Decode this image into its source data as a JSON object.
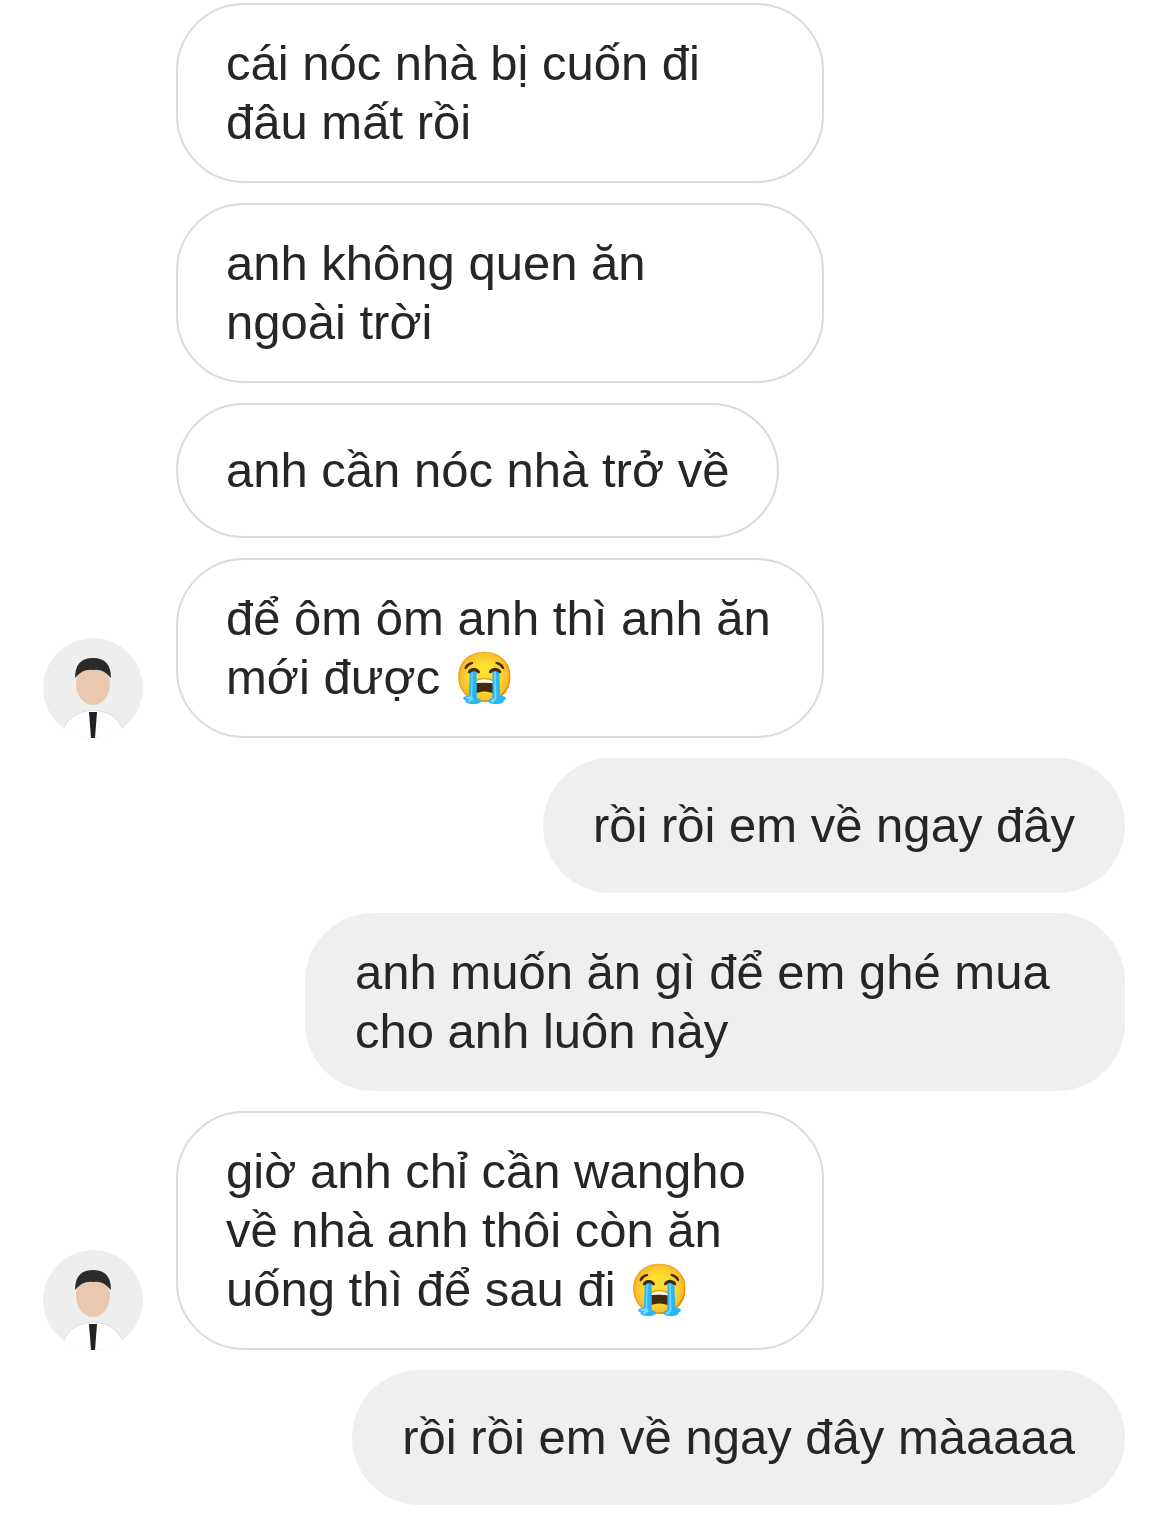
{
  "messages": [
    {
      "kind": "incoming",
      "text": "cái nóc nhà bị cuốn đi đâu mất rồi",
      "avatar": false
    },
    {
      "kind": "incoming",
      "text": "anh không quen ăn ngoài trời",
      "avatar": false
    },
    {
      "kind": "incoming",
      "text": "anh cần nóc nhà trở về",
      "avatar": false
    },
    {
      "kind": "incoming",
      "text": "để ôm ôm anh thì anh ăn mới được 😭",
      "avatar": true
    },
    {
      "kind": "outgoing",
      "text": "rồi rồi em về ngay đây"
    },
    {
      "kind": "outgoing",
      "text": "anh muốn ăn gì để em ghé mua cho anh luôn này"
    },
    {
      "kind": "incoming",
      "text": "giờ anh chỉ cần wangho về nhà anh thôi còn ăn uống thì để sau đi 😭",
      "avatar": true
    },
    {
      "kind": "outgoing",
      "text": "rồi rồi em về ngay đây màaaaa"
    }
  ]
}
